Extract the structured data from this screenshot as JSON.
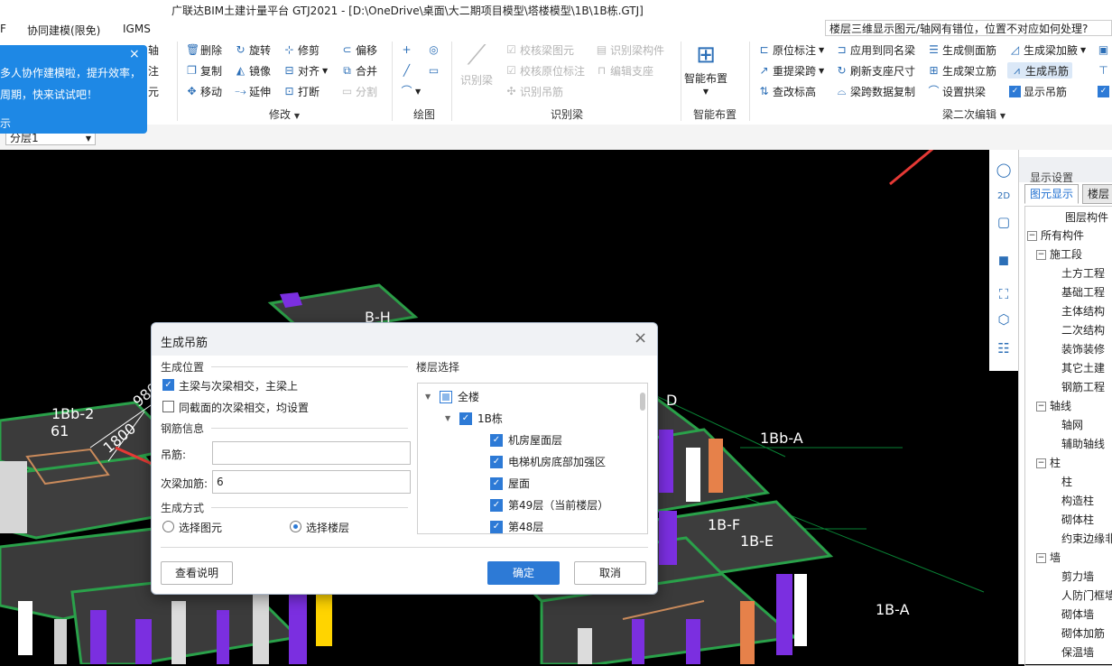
{
  "window": {
    "title": "广联达BIM土建计量平台 GTJ2021 - [D:\\OneDrive\\桌面\\大二期项目模型\\塔楼模型\\1B\\1B栋.GTJ]"
  },
  "menu": {
    "items": [
      "F",
      "协同建模(限免)",
      "IGMS"
    ]
  },
  "search": {
    "value": "楼层三维显示图元/轴网有错位，位置不对应如何处理?"
  },
  "popup": {
    "line1": "多人协作建模啦，提升效率，",
    "line2": "周期，快来试试吧！",
    "line3": "示",
    "close": "×",
    "side1": "轴",
    "side2": "注",
    "side3": "元"
  },
  "ribbon": {
    "modify": {
      "delete": "删除",
      "rotate": "旋转",
      "trim": "修剪",
      "offset": "偏移",
      "copy": "复制",
      "mirror": "镜像",
      "align": "对齐",
      "merge": "合并",
      "move": "移动",
      "extend": "延伸",
      "break": "打断",
      "split": "分割",
      "group": "修改"
    },
    "draw": {
      "group": "绘图"
    },
    "identify": {
      "identify_beam": "识别梁",
      "check_beam": "校核梁图元",
      "identify_beam_member": "识别梁构件",
      "check_origin_mark": "校核原位标注",
      "edit_support": "编辑支座",
      "identify_hanger": "识别吊筋",
      "group": "识别梁"
    },
    "smart": {
      "smart_layout": "智能布置",
      "group": "智能布置"
    },
    "beam2": {
      "origin_mark": "原位标注",
      "apply_same_name": "应用到同名梁",
      "gen_side_rebar": "生成侧面筋",
      "gen_haunch": "生成梁加腋",
      "re_span": "重提梁跨",
      "refresh_support": "刷新支座尺寸",
      "gen_stand_rebar": "生成架立筋",
      "gen_hanger": "生成吊筋",
      "query_elev": "查改标高",
      "span_copy": "梁跨数据复制",
      "set_arch": "设置拱梁",
      "show_hanger": "显示吊筋",
      "group": "梁二次编辑"
    }
  },
  "layer_select": {
    "value": "分层1"
  },
  "viewport": {
    "labels": [
      "1Bb-2",
      "61",
      "980",
      "1800",
      "1Bb-A",
      "1B-F",
      "1B-E",
      "1B-A",
      "D",
      "B-H"
    ]
  },
  "right_panel": {
    "header": "显示设置",
    "tabs": [
      "图元显示",
      "楼层"
    ],
    "column": "图层构件",
    "tree": [
      {
        "label": "所有构件",
        "level": 0,
        "expander": "−"
      },
      {
        "label": "施工段",
        "level": 1,
        "expander": "−"
      },
      {
        "label": "土方工程",
        "level": 2
      },
      {
        "label": "基础工程",
        "level": 2
      },
      {
        "label": "主体结构",
        "level": 2
      },
      {
        "label": "二次结构",
        "level": 2
      },
      {
        "label": "装饰装修",
        "level": 2
      },
      {
        "label": "其它土建",
        "level": 2
      },
      {
        "label": "钢筋工程",
        "level": 2
      },
      {
        "label": "轴线",
        "level": 1,
        "expander": "−"
      },
      {
        "label": "轴网",
        "level": 2
      },
      {
        "label": "辅助轴线",
        "level": 2
      },
      {
        "label": "柱",
        "level": 1,
        "expander": "−"
      },
      {
        "label": "柱",
        "level": 2
      },
      {
        "label": "构造柱",
        "level": 2
      },
      {
        "label": "砌体柱",
        "level": 2
      },
      {
        "label": "约束边缘非",
        "level": 2
      },
      {
        "label": "墙",
        "level": 1,
        "expander": "−"
      },
      {
        "label": "剪力墙",
        "level": 2
      },
      {
        "label": "人防门框墙",
        "level": 2
      },
      {
        "label": "砌体墙",
        "level": 2
      },
      {
        "label": "砌体加筋",
        "level": 2
      },
      {
        "label": "保温墙",
        "level": 2
      }
    ]
  },
  "dialog": {
    "title": "生成吊筋",
    "position_section": "生成位置",
    "opt_main_secondary": "主梁与次梁相交，主梁上",
    "opt_same_section": "同截面的次梁相交，均设置",
    "rebar_section": "钢筋信息",
    "hanger_label": "吊筋:",
    "hanger_value": "",
    "secondary_label": "次梁加筋:",
    "secondary_value": "6",
    "method_section": "生成方式",
    "method_select_elem": "选择图元",
    "method_select_floor": "选择楼层",
    "floor_section": "楼层选择",
    "floors": [
      {
        "label": "全楼",
        "level": 0,
        "checked": "partial"
      },
      {
        "label": "1B栋",
        "level": 1,
        "checked": "true"
      },
      {
        "label": "机房屋面层",
        "level": 2,
        "checked": "true"
      },
      {
        "label": "电梯机房底部加强区",
        "level": 2,
        "checked": "true"
      },
      {
        "label": "屋面",
        "level": 2,
        "checked": "true"
      },
      {
        "label": "第49层（当前楼层）",
        "level": 2,
        "checked": "true"
      },
      {
        "label": "第48层",
        "level": 2,
        "checked": "true"
      }
    ],
    "help_button": "查看说明",
    "ok_button": "确定",
    "cancel_button": "取消",
    "close": "×"
  },
  "colors": {
    "accent": "#2d7ad6",
    "popup": "#1e88e5",
    "arrow": "#e53935"
  }
}
